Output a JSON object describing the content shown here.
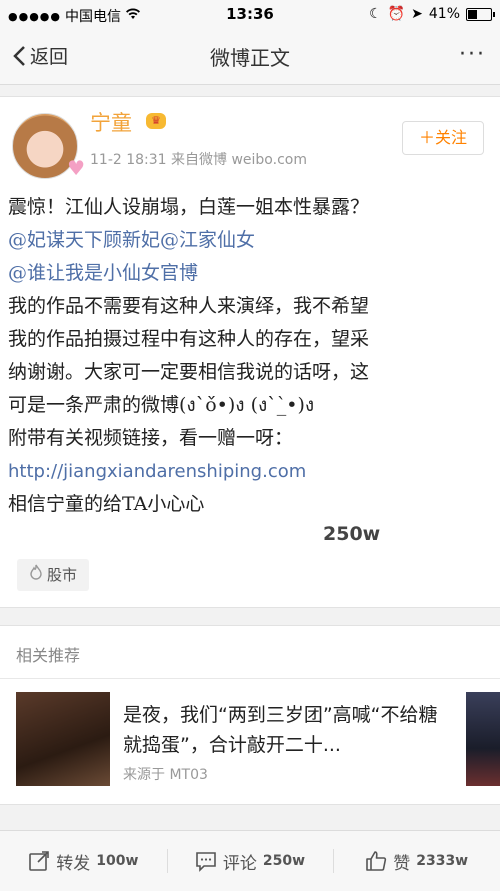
{
  "status_bar": {
    "carrier": "中国电信",
    "time": "13:36",
    "battery": "41%"
  },
  "nav": {
    "back_label": "返回",
    "title": "微博正文",
    "more_label": "···"
  },
  "post": {
    "username": "宁童",
    "meta": "11-2 18:31  来自微博 weibo.com",
    "follow_label": "＋关注",
    "lines": [
      "震惊！江仙人设崩塌，白莲一姐本性暴露？",
      "@妃谋天下顾新妃@江家仙女",
      "@谁让我是小仙女官博",
      "我的作品不需要有这种人来演绎，我不希望",
      "我的作品拍摄过程中有这种人的存在，望采",
      "纳谢谢。大家可一定要相信我说的话呀，这",
      "可是一条严肃的微博(ง`̀ὸ́•)ง (ง`̀_̀•)ง",
      "附带有关视频链接，看一赠一呀：",
      "http://jiangxiandarenshiping.com",
      "相信宁童的给TA小心心"
    ],
    "count_label": "250w",
    "tag_label": "股市"
  },
  "related": {
    "header": "相关推荐",
    "title": "是夜，我们“两到三岁团”高喊“不给糖就捣蛋”，合计敲开二十...",
    "source": "来源于 MT03"
  },
  "toolbar": {
    "repost_label": "转发",
    "repost_count": "100w",
    "comment_label": "评论",
    "comment_count": "250w",
    "like_label": "赞",
    "like_count": "2333w"
  },
  "colors": {
    "accent_orange": "#ff8200",
    "username_color": "#f2a33a",
    "mention_blue": "#4f6fa7"
  }
}
